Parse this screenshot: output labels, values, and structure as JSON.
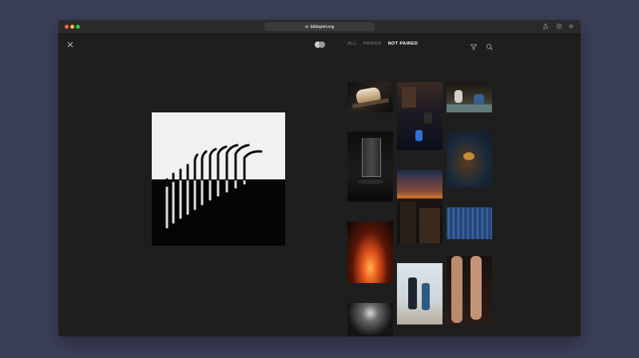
{
  "browser": {
    "url": "bildspiel.org"
  },
  "header": {
    "filters": [
      {
        "label": "ALL",
        "active": false
      },
      {
        "label": "PAIRED",
        "active": false
      },
      {
        "label": "NOT PAIRED",
        "active": true
      }
    ]
  },
  "icons": {
    "close": "close-icon",
    "logo": "logo-icon",
    "filter": "filter-icon",
    "search": "search-icon",
    "share": "share-icon",
    "extensions": "extensions-icon",
    "new_tab": "plus-icon"
  },
  "colors": {
    "desktop": "#3b3f58",
    "window": "#1e1e1e",
    "active_filter": "#ffffff",
    "inactive_filter": "#6a6a6a"
  },
  "thumbnails": [
    {
      "name": "thumb-bread-on-board"
    },
    {
      "name": "thumb-night-street-blue-figure"
    },
    {
      "name": "thumb-children-reading"
    },
    {
      "name": "thumb-glass-of-water"
    },
    {
      "name": "thumb-crab-in-water"
    },
    {
      "name": "thumb-sunset-buildings"
    },
    {
      "name": "thumb-blue-curtain"
    },
    {
      "name": "thumb-fire-sparks"
    },
    {
      "name": "thumb-two-people-beach"
    },
    {
      "name": "thumb-tattooed-legs"
    },
    {
      "name": "thumb-light-window"
    }
  ]
}
